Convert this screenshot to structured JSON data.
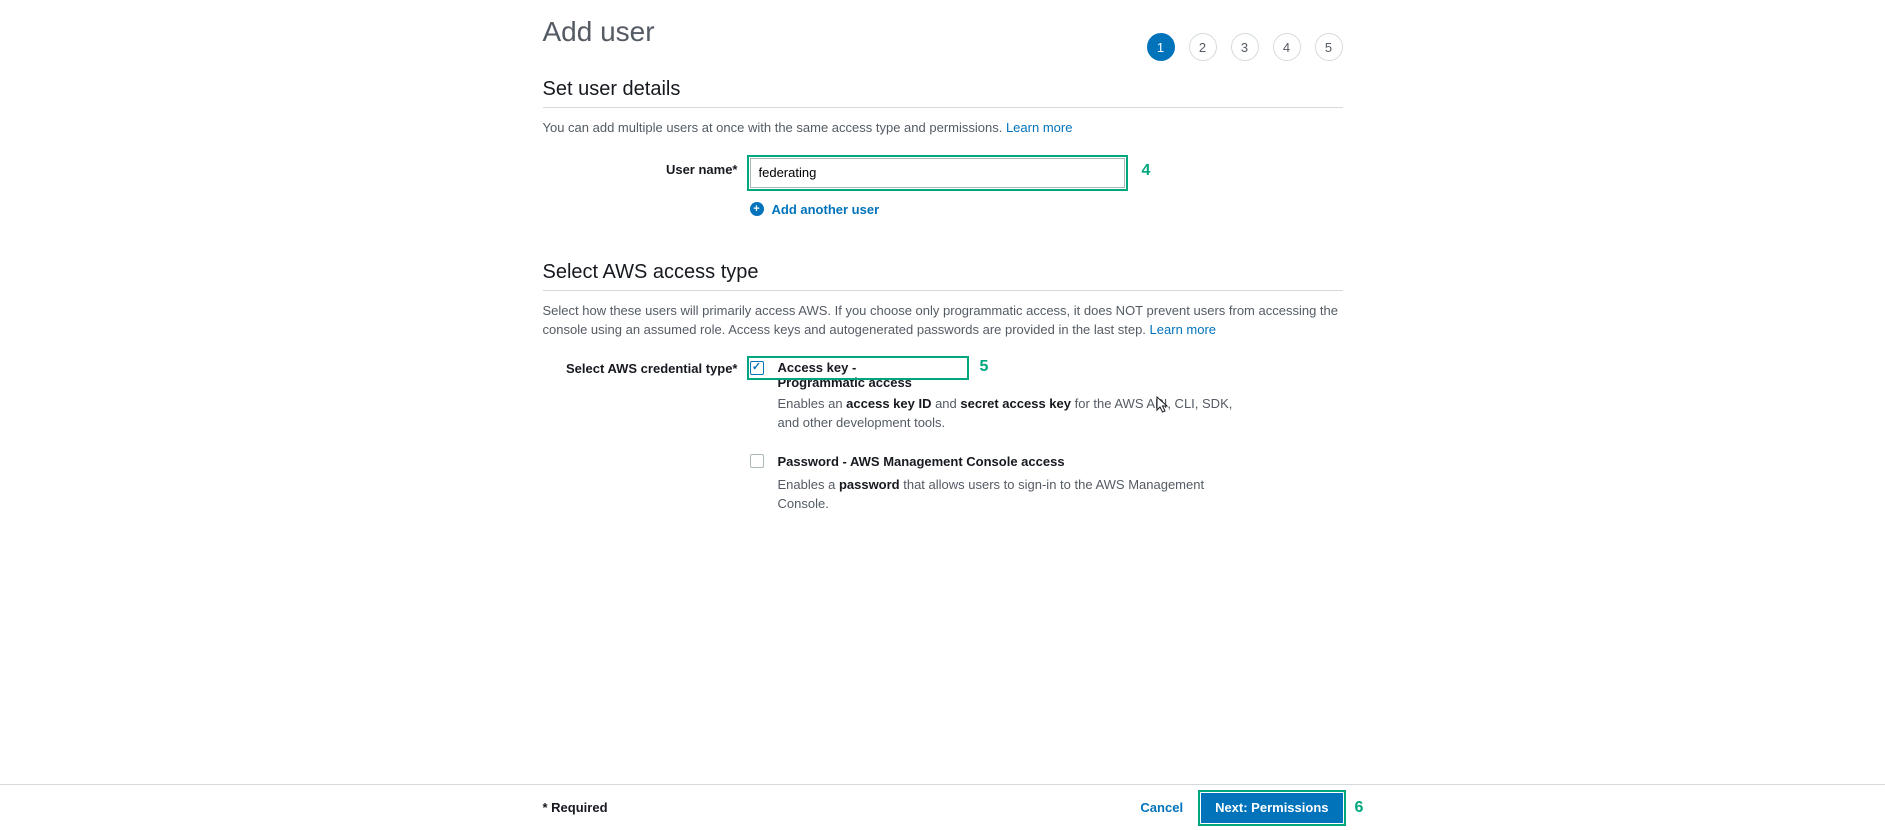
{
  "header": {
    "title": "Add user",
    "steps": [
      "1",
      "2",
      "3",
      "4",
      "5"
    ],
    "active_step": 0
  },
  "section1": {
    "title": "Set user details",
    "desc": "You can add multiple users at once with the same access type and permissions.",
    "learn_more": "Learn more",
    "username_label": "User name*",
    "username_value": "federating",
    "add_another": "Add another user"
  },
  "section2": {
    "title": "Select AWS access type",
    "desc": "Select how these users will primarily access AWS. If you choose only programmatic access, it does NOT prevent users from accessing the console using an assumed role. Access keys and autogenerated passwords are provided in the last step.",
    "learn_more": "Learn more",
    "cred_label": "Select AWS credential type*",
    "opt1": {
      "checked": true,
      "title": "Access key - Programmatic access",
      "desc_pre": "Enables an ",
      "desc_b1": "access key ID",
      "desc_mid": " and ",
      "desc_b2": "secret access key",
      "desc_post": " for the AWS API, CLI, SDK, and other development tools."
    },
    "opt2": {
      "checked": false,
      "title": "Password - AWS Management Console access",
      "desc_pre": "Enables a ",
      "desc_b1": "password",
      "desc_post": " that allows users to sign-in to the AWS Management Console."
    }
  },
  "footer": {
    "required": "* Required",
    "cancel": "Cancel",
    "next": "Next: Permissions"
  },
  "annotations": {
    "n4": "4",
    "n5": "5",
    "n6": "6"
  }
}
